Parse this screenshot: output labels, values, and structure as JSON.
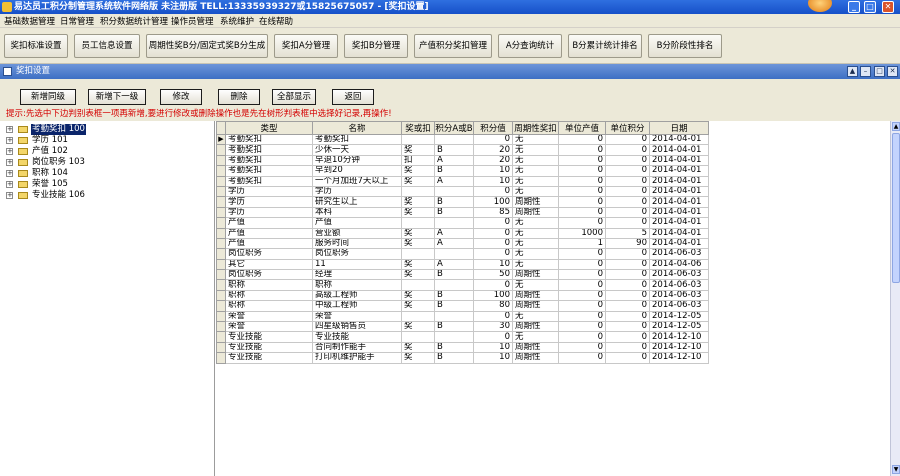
{
  "window": {
    "title": "易达员工积分制管理系统软件网络版 未注册版 TELL:13335939327或15825675057 - [奖扣设置]",
    "min_icon": "minimize-icon",
    "max_icon": "maximize-icon",
    "close_icon": "close-icon"
  },
  "menu": [
    "基础数据管理",
    "日常管理",
    "积分数据统计管理",
    "操作员管理",
    "系统维护",
    "在线帮助"
  ],
  "toolbar": [
    "奖扣标准设置",
    "员工信息设置",
    "周期性奖B分/固定式奖B分生成",
    "奖扣A分管理",
    "奖扣B分管理",
    "产值积分奖扣管理",
    "A分查询统计",
    "B分累计统计排名",
    "B分阶段性排名"
  ],
  "subwindow": {
    "title": "奖扣设置"
  },
  "actions": [
    "新增同级",
    "新增下一级",
    "修改",
    "删除",
    "全部显示",
    "返回"
  ],
  "hint": "提示:先选中下边判别表框一项再新增,要进行修改或删除操作也是先在树形判表框中选择好记录,再操作!",
  "tree": [
    {
      "label": "考勤奖扣  100",
      "selected": true
    },
    {
      "label": "学历  101",
      "selected": false
    },
    {
      "label": "产值  102",
      "selected": false
    },
    {
      "label": "岗位职务  103",
      "selected": false
    },
    {
      "label": "职称  104",
      "selected": false
    },
    {
      "label": "荣誉  105",
      "selected": false
    },
    {
      "label": "专业技能  106",
      "selected": false
    }
  ],
  "grid": {
    "columns": [
      "类型",
      "名称",
      "奖或扣",
      "积分A或B",
      "积分值",
      "周期性奖扣",
      "单位产值",
      "单位积分",
      "日期"
    ],
    "rows": [
      [
        "考勤奖扣",
        "考勤奖扣",
        "",
        "",
        "0",
        "无",
        "0",
        "0",
        "2014-04-01"
      ],
      [
        "考勤奖扣",
        "少休一天",
        "奖",
        "B",
        "20",
        "无",
        "0",
        "0",
        "2014-04-01"
      ],
      [
        "考勤奖扣",
        "早退10分钟",
        "扣",
        "A",
        "20",
        "无",
        "0",
        "0",
        "2014-04-01"
      ],
      [
        "考勤奖扣",
        "早到20",
        "奖",
        "B",
        "10",
        "无",
        "0",
        "0",
        "2014-04-01"
      ],
      [
        "考勤奖扣",
        "一个月加班7天以上",
        "奖",
        "A",
        "10",
        "无",
        "0",
        "0",
        "2014-04-01"
      ],
      [
        "学历",
        "学历",
        "",
        "",
        "0",
        "无",
        "0",
        "0",
        "2014-04-01"
      ],
      [
        "学历",
        "研究生以上",
        "奖",
        "B",
        "100",
        "周期性",
        "0",
        "0",
        "2014-04-01"
      ],
      [
        "学历",
        "本科",
        "奖",
        "B",
        "85",
        "周期性",
        "0",
        "0",
        "2014-04-01"
      ],
      [
        "产值",
        "产值",
        "",
        "",
        "0",
        "无",
        "0",
        "0",
        "2014-04-01"
      ],
      [
        "产值",
        "营业额",
        "奖",
        "A",
        "0",
        "无",
        "1000",
        "5",
        "2014-04-01"
      ],
      [
        "产值",
        "服务时间",
        "奖",
        "A",
        "0",
        "无",
        "1",
        "90",
        "2014-04-01"
      ],
      [
        "岗位职务",
        "岗位职务",
        "",
        "",
        "0",
        "无",
        "0",
        "0",
        "2014-06-03"
      ],
      [
        "其它",
        "11",
        "奖",
        "A",
        "10",
        "无",
        "0",
        "0",
        "2014-04-06"
      ],
      [
        "岗位职务",
        "经理",
        "奖",
        "B",
        "50",
        "周期性",
        "0",
        "0",
        "2014-06-03"
      ],
      [
        "职称",
        "职称",
        "",
        "",
        "0",
        "无",
        "0",
        "0",
        "2014-06-03"
      ],
      [
        "职称",
        "高级工程师",
        "奖",
        "B",
        "100",
        "周期性",
        "0",
        "0",
        "2014-06-03"
      ],
      [
        "职称",
        "中级工程师",
        "奖",
        "B",
        "80",
        "周期性",
        "0",
        "0",
        "2014-06-03"
      ],
      [
        "荣誉",
        "荣誉",
        "",
        "",
        "0",
        "无",
        "0",
        "0",
        "2014-12-05"
      ],
      [
        "荣誉",
        "四星级销售员",
        "奖",
        "B",
        "30",
        "周期性",
        "0",
        "0",
        "2014-12-05"
      ],
      [
        "专业技能",
        "专业技能",
        "",
        "",
        "0",
        "无",
        "0",
        "0",
        "2014-12-10"
      ],
      [
        "专业技能",
        "合同制作能手",
        "奖",
        "B",
        "10",
        "周期性",
        "0",
        "0",
        "2014-12-10"
      ],
      [
        "专业技能",
        "打印机维护能手",
        "奖",
        "B",
        "10",
        "周期性",
        "0",
        "0",
        "2014-12-10"
      ]
    ]
  }
}
